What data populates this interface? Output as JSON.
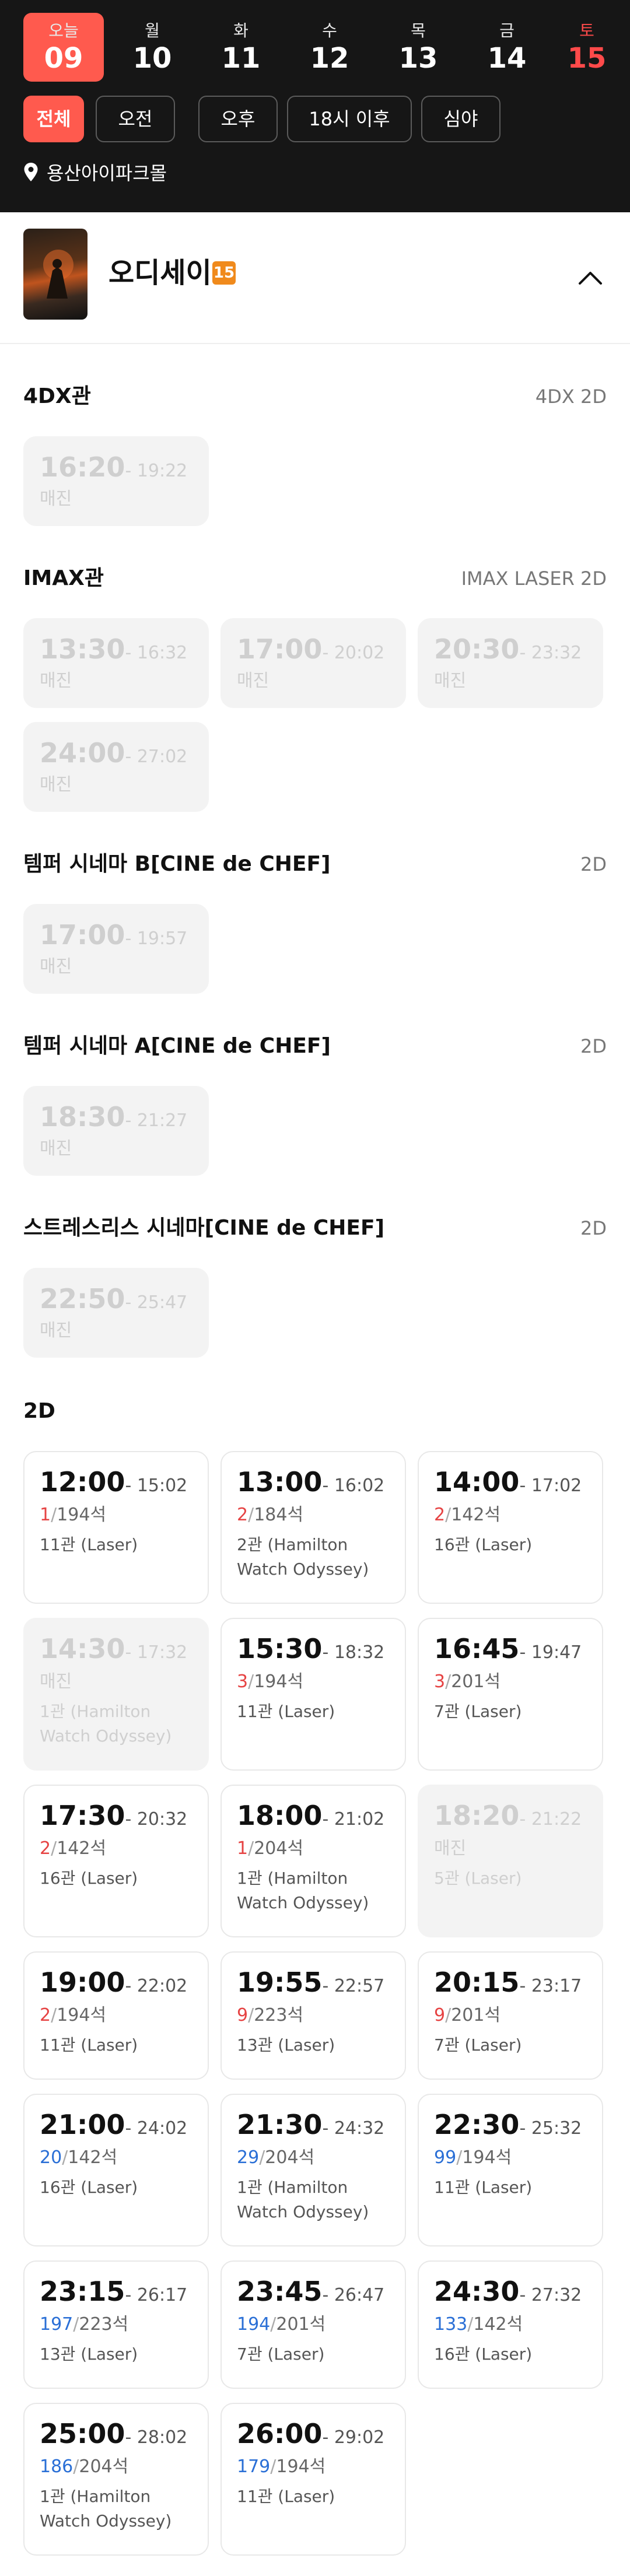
{
  "dates": [
    {
      "weekday": "오늘",
      "day": "09",
      "active": true,
      "saturday": false
    },
    {
      "weekday": "월",
      "day": "10",
      "active": false,
      "saturday": false
    },
    {
      "weekday": "화",
      "day": "11",
      "active": false,
      "saturday": false
    },
    {
      "weekday": "수",
      "day": "12",
      "active": false,
      "saturday": false
    },
    {
      "weekday": "목",
      "day": "13",
      "active": false,
      "saturday": false
    },
    {
      "weekday": "금",
      "day": "14",
      "active": false,
      "saturday": false
    },
    {
      "weekday": "토",
      "day": "15",
      "active": false,
      "saturday": true
    }
  ],
  "filters": [
    "전체",
    "오전",
    "오후",
    "18시 이후",
    "심야"
  ],
  "active_filter": "전체",
  "location": "용산아이파크몰",
  "movie": {
    "title": "오디세이",
    "age_rating": "15"
  },
  "labels": {
    "sold_out": "매진",
    "seat_unit": "석"
  },
  "colors": {
    "accent": "#ff5a4e",
    "header_bg": "#161616",
    "remaining_red": "#e64343",
    "remaining_blue": "#2a6fd6"
  },
  "sections": [
    {
      "name": "4DX관",
      "format": "4DX 2D",
      "showtimes": [
        {
          "start": "16:20",
          "end": "19:22",
          "sold_out": true
        }
      ]
    },
    {
      "name": "IMAX관",
      "format": "IMAX LASER 2D",
      "showtimes": [
        {
          "start": "13:30",
          "end": "16:32",
          "sold_out": true
        },
        {
          "start": "17:00",
          "end": "20:02",
          "sold_out": true
        },
        {
          "start": "20:30",
          "end": "23:32",
          "sold_out": true
        },
        {
          "start": "24:00",
          "end": "27:02",
          "sold_out": true
        }
      ]
    },
    {
      "name": "템퍼 시네마 B[CINE de CHEF]",
      "format": "2D",
      "showtimes": [
        {
          "start": "17:00",
          "end": "19:57",
          "sold_out": true
        }
      ]
    },
    {
      "name": "템퍼 시네마 A[CINE de CHEF]",
      "format": "2D",
      "showtimes": [
        {
          "start": "18:30",
          "end": "21:27",
          "sold_out": true
        }
      ]
    },
    {
      "name": "스트레스리스 시네마[CINE de CHEF]",
      "format": "2D",
      "showtimes": [
        {
          "start": "22:50",
          "end": "25:47",
          "sold_out": true
        }
      ]
    },
    {
      "name": "2D",
      "format": "",
      "showtimes": [
        {
          "start": "12:00",
          "end": "15:02",
          "remaining": "1",
          "total": "194",
          "hall": "11관 (Laser)",
          "color": "red"
        },
        {
          "start": "13:00",
          "end": "16:02",
          "remaining": "2",
          "total": "184",
          "hall": "2관 (Hamilton Watch Odyssey)",
          "color": "red"
        },
        {
          "start": "14:00",
          "end": "17:02",
          "remaining": "2",
          "total": "142",
          "hall": "16관 (Laser)",
          "color": "red"
        },
        {
          "start": "14:30",
          "end": "17:32",
          "sold_out": true,
          "hall": "1관 (Hamilton Watch Odyssey)"
        },
        {
          "start": "15:30",
          "end": "18:32",
          "remaining": "3",
          "total": "194",
          "hall": "11관 (Laser)",
          "color": "red"
        },
        {
          "start": "16:45",
          "end": "19:47",
          "remaining": "3",
          "total": "201",
          "hall": "7관 (Laser)",
          "color": "red"
        },
        {
          "start": "17:30",
          "end": "20:32",
          "remaining": "2",
          "total": "142",
          "hall": "16관 (Laser)",
          "color": "red"
        },
        {
          "start": "18:00",
          "end": "21:02",
          "remaining": "1",
          "total": "204",
          "hall": "1관 (Hamilton Watch Odyssey)",
          "color": "red"
        },
        {
          "start": "18:20",
          "end": "21:22",
          "sold_out": true,
          "hall": "5관 (Laser)"
        },
        {
          "start": "19:00",
          "end": "22:02",
          "remaining": "2",
          "total": "194",
          "hall": "11관 (Laser)",
          "color": "red"
        },
        {
          "start": "19:55",
          "end": "22:57",
          "remaining": "9",
          "total": "223",
          "hall": "13관 (Laser)",
          "color": "red"
        },
        {
          "start": "20:15",
          "end": "23:17",
          "remaining": "9",
          "total": "201",
          "hall": "7관 (Laser)",
          "color": "red"
        },
        {
          "start": "21:00",
          "end": "24:02",
          "remaining": "20",
          "total": "142",
          "hall": "16관 (Laser)",
          "color": "blue"
        },
        {
          "start": "21:30",
          "end": "24:32",
          "remaining": "29",
          "total": "204",
          "hall": "1관 (Hamilton Watch Odyssey)",
          "color": "blue"
        },
        {
          "start": "22:30",
          "end": "25:32",
          "remaining": "99",
          "total": "194",
          "hall": "11관 (Laser)",
          "color": "blue"
        },
        {
          "start": "23:15",
          "end": "26:17",
          "remaining": "197",
          "total": "223",
          "hall": "13관 (Laser)",
          "color": "blue"
        },
        {
          "start": "23:45",
          "end": "26:47",
          "remaining": "194",
          "total": "201",
          "hall": "7관 (Laser)",
          "color": "blue"
        },
        {
          "start": "24:30",
          "end": "27:32",
          "remaining": "133",
          "total": "142",
          "hall": "16관 (Laser)",
          "color": "blue"
        },
        {
          "start": "25:00",
          "end": "28:02",
          "remaining": "186",
          "total": "204",
          "hall": "1관 (Hamilton Watch Odyssey)",
          "color": "blue"
        },
        {
          "start": "26:00",
          "end": "29:02",
          "remaining": "179",
          "total": "194",
          "hall": "11관 (Laser)",
          "color": "blue"
        }
      ]
    }
  ]
}
